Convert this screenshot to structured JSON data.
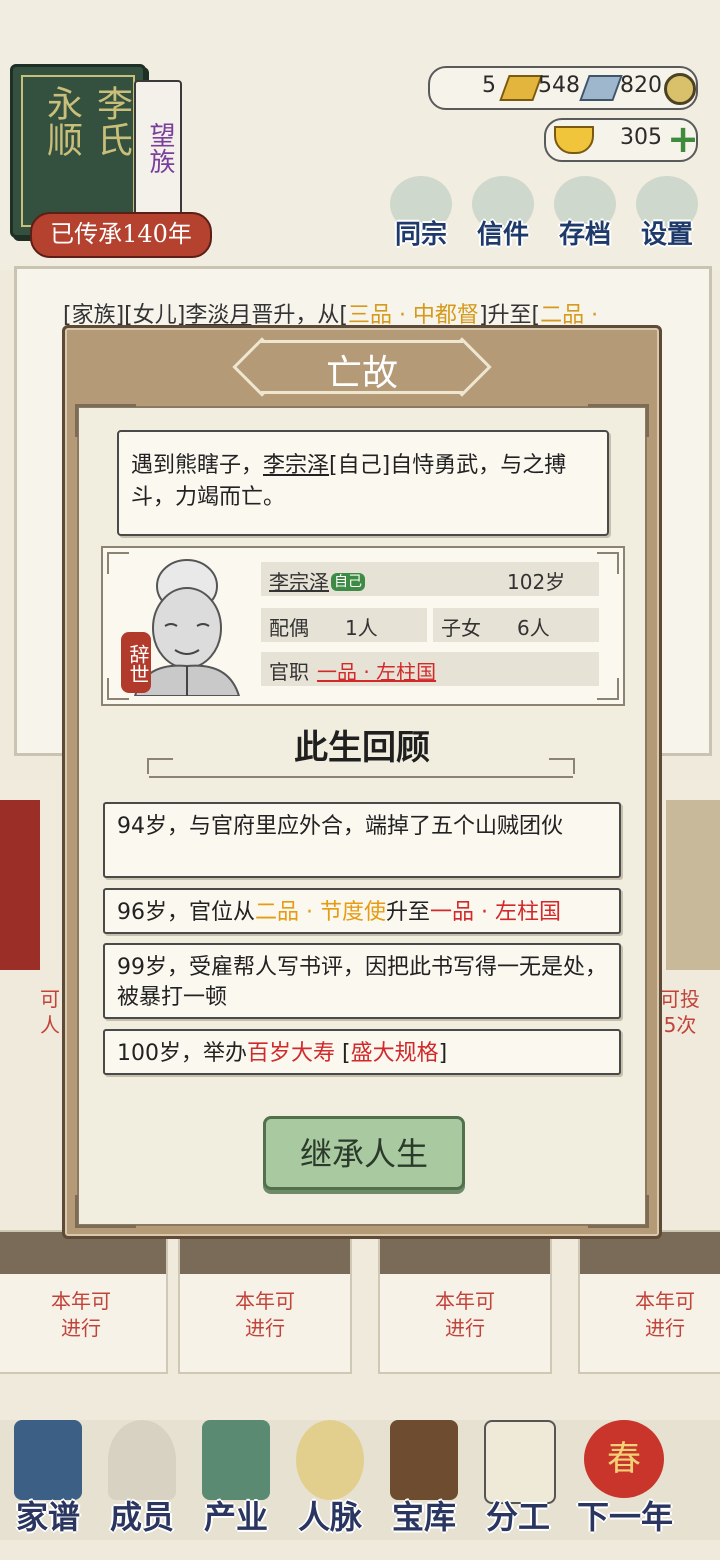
{
  "header": {
    "clan_name_1": "永顺",
    "clan_name_2": "李氏",
    "clan_rank": "望族",
    "heritage": "已传承140年",
    "resources": {
      "gold_bars": "5",
      "silver_bars": "548",
      "coins": "820",
      "ingots": "305"
    },
    "menu": [
      {
        "label": "同宗",
        "icon": "clan-book-icon"
      },
      {
        "label": "信件",
        "icon": "letter-icon"
      },
      {
        "label": "存档",
        "icon": "save-brush-icon"
      },
      {
        "label": "设置",
        "icon": "settings-icon"
      }
    ]
  },
  "log": {
    "prefix": "[家族][女儿]",
    "name": "李淡月",
    "mid": "晋升，从[",
    "from_rank": "三品 · 中都督",
    "mid2": "]升至[",
    "to_rank": "二品 ·"
  },
  "side": {
    "left_text": "可\n人",
    "right_text": "可投\n5次"
  },
  "bottom_cards": [
    {
      "line1": "本年可",
      "line2": "进行"
    },
    {
      "line1": "本年可",
      "line2": "进行"
    },
    {
      "line1": "本年可",
      "line2": "进行"
    },
    {
      "line1": "本年可",
      "line2": "进行"
    }
  ],
  "nav": [
    {
      "label": "家谱",
      "icon": "genealogy-icon"
    },
    {
      "label": "成员",
      "icon": "member-icon"
    },
    {
      "label": "产业",
      "icon": "industry-icon"
    },
    {
      "label": "人脉",
      "icon": "network-icon"
    },
    {
      "label": "宝库",
      "icon": "treasury-icon"
    },
    {
      "label": "分工",
      "icon": "scroll-icon"
    },
    {
      "label": "下一年",
      "icon": "next-year-lantern-icon",
      "lantern_text": "春"
    }
  ],
  "modal": {
    "title": "亡故",
    "desc_pre": "遇到熊瞎子，",
    "desc_name": "李宗泽",
    "desc_post": "[自己]自恃勇武，与之搏斗，力竭而亡。",
    "character": {
      "name": "李宗泽",
      "self_tag": "自己",
      "age": "102岁",
      "spouse_label": "配偶",
      "spouse_value": "1人",
      "children_label": "子女",
      "children_value": "6人",
      "office_label": "官职",
      "office_value": "一品 · 左柱国",
      "status_stamp": "辞世"
    },
    "review_title": "此生回顾",
    "events": [
      {
        "text": "94岁，与官府里应外合，端掉了五个山贼团伙"
      },
      {
        "pre": "96岁，官位从",
        "from": "二品 · 节度使",
        "mid": "升至",
        "to": "一品 · 左柱国"
      },
      {
        "text": "99岁，受雇帮人写书评，因把此书写得一无是处，被暴打一顿"
      },
      {
        "pre": "100岁，举办",
        "red1": "百岁大寿",
        "mid": " [",
        "red2": "盛大规格",
        "post": "]"
      }
    ],
    "button_label": "继承人生"
  },
  "colors": {
    "accent_red": "#d2292b",
    "accent_orange": "#e59c12",
    "button_green": "#a9c9a0",
    "modal_frame": "#b59a78"
  }
}
